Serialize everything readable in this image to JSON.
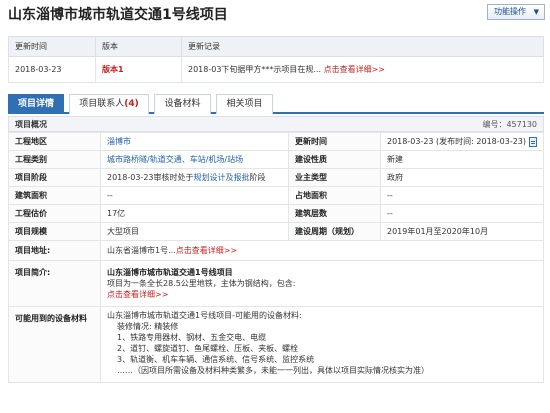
{
  "title": "山东淄博市城市轨道交通1号线项目",
  "function_button": "功能操作",
  "update_table": {
    "headers": [
      "更新时间",
      "版本",
      "更新记录"
    ],
    "row": {
      "date": "2018-03-23",
      "version": "版本1",
      "record": "2018-03下旬据甲方***示项目在规...",
      "link": "点击查看详细>>"
    }
  },
  "tabs": [
    {
      "label": "项目详情",
      "count": ""
    },
    {
      "label": "项目联系人",
      "count": "(4)"
    },
    {
      "label": "设备材料",
      "count": ""
    },
    {
      "label": "相关项目",
      "count": ""
    }
  ],
  "overview": {
    "label": "项目概况",
    "code_label": "编号：",
    "code": "457130"
  },
  "info": {
    "region_k": "工程地区",
    "region_v": "淄博市",
    "update_k": "更新时间",
    "update_v": "2018-03-23 (发布时间: 2018-03-23)",
    "category_k": "工程类别",
    "category_v": "城市路桥隧/轨道交通、车站/机场/站场",
    "nature_k": "建设性质",
    "nature_v": "新建",
    "stage_k": "项目阶段",
    "stage_prefix": "2018-03-23审核时处于",
    "stage_link": "规划设计及报批",
    "stage_suffix": "阶段",
    "owner_k": "业主类型",
    "owner_v": "政府",
    "area_k": "建筑面积",
    "area_v": "--",
    "land_k": "占地面积",
    "land_v": "--",
    "cost_k": "工程估价",
    "cost_v": "17亿",
    "floors_k": "建筑层数",
    "floors_v": "--",
    "scale_k": "项目规模",
    "scale_v": "大型项目",
    "period_k": "建设周期（规划）",
    "period_v": "2019年01月至2020年10月",
    "addr_k": "项目地址:",
    "addr_v": "山东省淄博市1号...",
    "addr_link": "点击查看详细>>",
    "intro_k": "项目简介:",
    "intro_title": "山东淄博市城市轨道交通1号线项目",
    "intro_text": "项目为一条全长28.5公里地铁，主体为钢结构，包含:",
    "intro_link": "点击查看详细>>",
    "eq_k": "可能用到的设备材料",
    "eq_lines": [
      "山东淄博市城市轨道交通1号线项目-可能用的设备材料:",
      "装修情况: 精装修",
      "1、铁路专用器材、钢材、五金交电、电缆",
      "2、道钉、螺旋道钉、鱼尾螺栓、压板、夹板、螺栓",
      "3、轨道衡、机车车辆、通信系统、信号系统、监控系统",
      "……（因项目所需设备及材料种类繁多，未能一一列出，具体以项目实际情况核实为准）"
    ]
  },
  "colors": {
    "accent": "#2f6fb2",
    "link": "#1f5fa8",
    "highlight": "#c81e1e"
  }
}
